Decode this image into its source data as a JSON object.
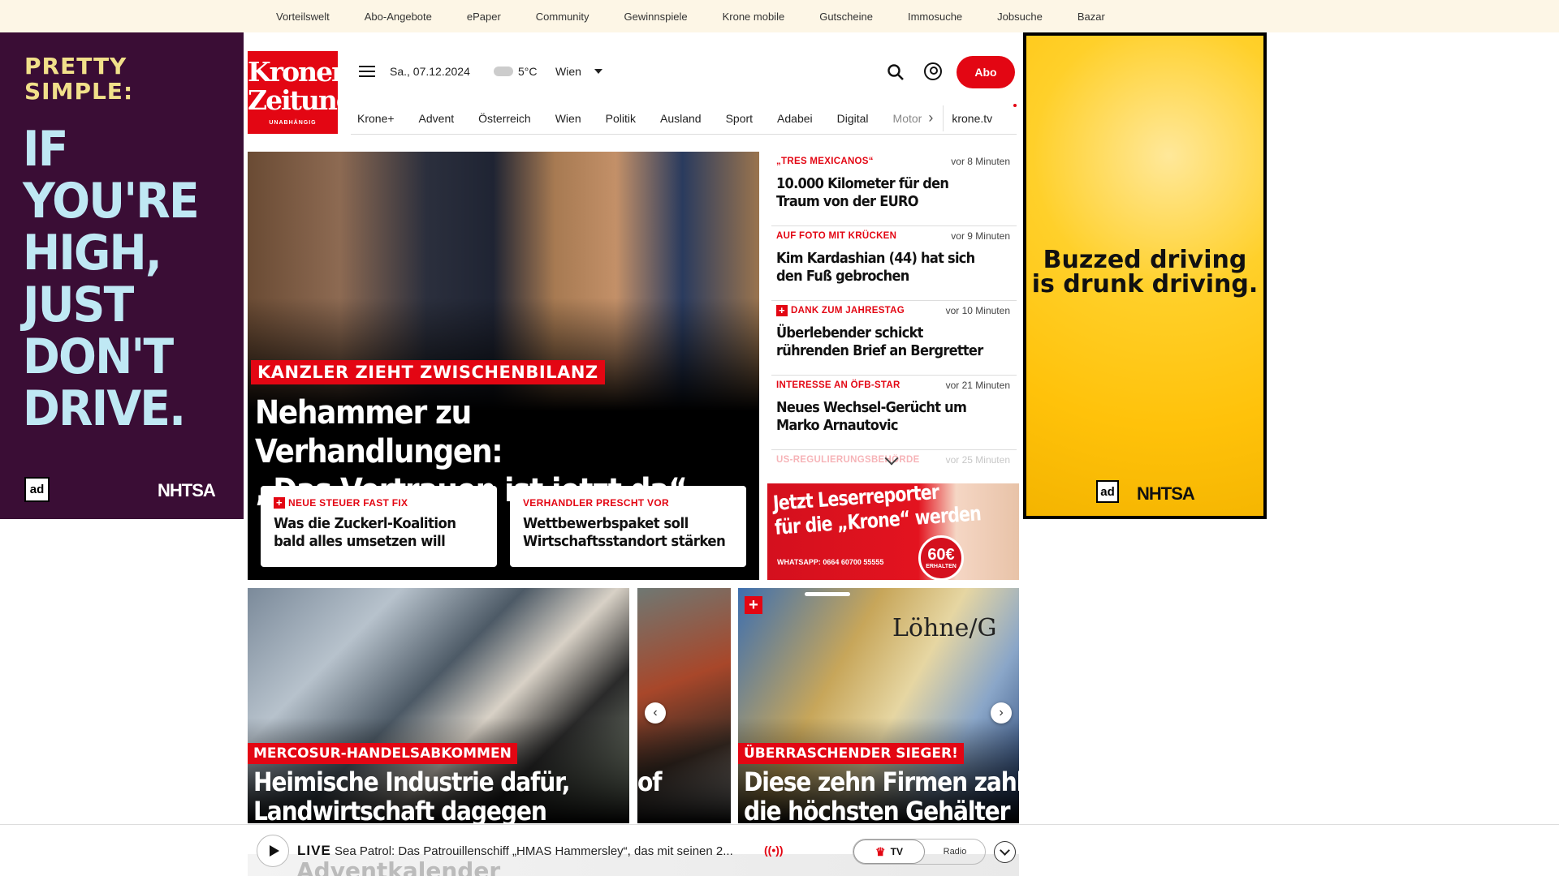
{
  "topbar": {
    "links": [
      "Vorteilswelt",
      "Abo-Angebote",
      "ePaper",
      "Community",
      "Gewinnspiele",
      "Krone mobile",
      "Gutscheine",
      "Immosuche",
      "Jobsuche",
      "Bazar"
    ]
  },
  "ads": {
    "left": {
      "line1": "PRETTY",
      "line2": "SIMPLE:",
      "big": [
        "IF",
        "YOU'RE",
        "HIGH,",
        "JUST",
        "DON'T",
        "DRIVE."
      ],
      "ad_logo": "ad",
      "nhtsa": "NHTSA",
      "bg": "#3a0d35"
    },
    "right": {
      "line1": "Buzzed driving",
      "line2": "is drunk driving.",
      "ad_logo": "ad",
      "nhtsa": "NHTSA"
    }
  },
  "header": {
    "logo": {
      "line1": "Kronen",
      "line2": "Zeitung",
      "line3": "UNABHÄNGIG"
    },
    "date": "Sa., 07.12.2024",
    "temperature": "5°C",
    "city": "Wien",
    "abo_label": "Abo",
    "icons": {
      "menu": "hamburger-icon",
      "search": "search-icon",
      "account": "user-icon"
    },
    "accent": "#e30613"
  },
  "nav": {
    "items": [
      "Krone+",
      "Advent",
      "Österreich",
      "Wien",
      "Politik",
      "Ausland",
      "Sport",
      "Adabei",
      "Digital",
      "Motor"
    ],
    "tv": "krone.tv"
  },
  "hero": {
    "kicker": "KANZLER ZIEHT ZWISCHENBILANZ",
    "headline_1": "Nehammer zu Verhandlungen:",
    "headline_2": "„Das Vertrauen ist jetzt da“",
    "sub": [
      {
        "kicker": "NEUE STEUER FAST FIX",
        "plus": true,
        "title": "Was die Zuckerl-Koalition bald alles umsetzen will"
      },
      {
        "kicker": "VERHANDLER PRESCHT VOR",
        "plus": false,
        "title": "Wettbewerbspaket soll Wirtschaftsstandort stärken"
      }
    ]
  },
  "news": [
    {
      "kicker": "„TRES MEXICANOS“",
      "time": "vor 8 Minuten",
      "title": "10.000 Kilometer für den Traum von der EURO",
      "plus": false
    },
    {
      "kicker": "AUF FOTO MIT KRÜCKEN",
      "time": "vor 9 Minuten",
      "title": "Kim Kardashian (44) hat sich den Fuß gebrochen",
      "plus": false
    },
    {
      "kicker": "DANK ZUM JAHRESTAG",
      "time": "vor 10 Minuten",
      "title": "Überlebender schickt rührenden Brief an Bergretter",
      "plus": true
    },
    {
      "kicker": "INTERESSE AN ÖFB-STAR",
      "time": "vor 21 Minuten",
      "title": "Neues Wechsel-Gerücht um Marko Arnautovic",
      "plus": false
    },
    {
      "kicker": "US-REGULIERUNGSBEHÖRDE",
      "time": "vor 25 Minuten",
      "title": "",
      "plus": false
    }
  ],
  "reporter": {
    "title_1": "Jetzt Leserreporter",
    "title_2": "für die „Krone“ werden",
    "whatsapp": "WHATSAPP: 0664 60700 55555",
    "amount": "60€",
    "amount_label": "ERHALTEN"
  },
  "carousel": [
    {
      "kicker": "MERCOSUR-HANDELSABKOMMEN",
      "title_1": "Heimische Industrie dafür,",
      "title_2": "Landwirtschaft dagegen"
    },
    {
      "kicker": "",
      "title_1": "",
      "title_2": "of"
    },
    {
      "kicker": "ÜBERRASCHENDER SIEGER!",
      "title_1": "Diese zehn Firmen zahlen",
      "title_2": "die höchsten Gehälter",
      "image_text": "Löhne/G"
    }
  ],
  "live": {
    "label": "LIVE",
    "title": "Sea Patrol: Das Patrouillenschiff „HMAS Hammersley“, das mit seinen 2...",
    "tv": "TV",
    "radio": "Radio",
    "peek": "Adventkalender"
  }
}
